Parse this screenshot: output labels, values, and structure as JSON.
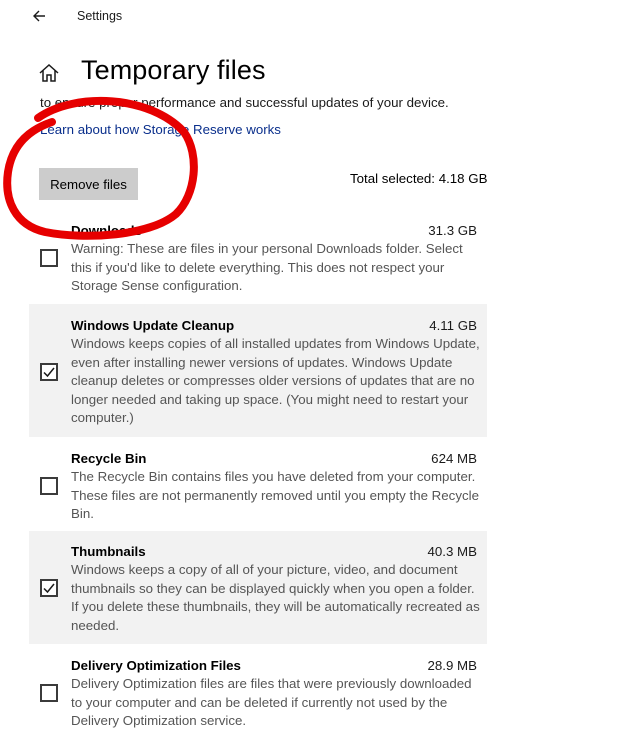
{
  "window": {
    "title": "Settings"
  },
  "page": {
    "title": "Temporary files",
    "description": "to ensure proper performance and successful updates of your device.",
    "learn_link": "Learn about how Storage Reserve works",
    "remove_button": "Remove files",
    "total_selected": "Total selected: 4.18 GB"
  },
  "items": [
    {
      "name": "Downloads",
      "size": "31.3 GB",
      "checked": false,
      "description": "Warning: These are files in your personal Downloads folder. Select this if you'd like to delete everything. This does not respect your Storage Sense configuration."
    },
    {
      "name": "Windows Update Cleanup",
      "size": "4.11 GB",
      "checked": true,
      "description": "Windows keeps copies of all installed updates from Windows Update, even after installing newer versions of updates. Windows Update cleanup deletes or compresses older versions of updates that are no longer needed and taking up space. (You might need to restart your computer.)"
    },
    {
      "name": "Recycle Bin",
      "size": "624 MB",
      "checked": false,
      "description": "The Recycle Bin contains files you have deleted from your computer. These files are not permanently removed until you empty the Recycle Bin."
    },
    {
      "name": "Thumbnails",
      "size": "40.3 MB",
      "checked": true,
      "description": "Windows keeps a copy of all of your picture, video, and document thumbnails so they can be displayed quickly when you open a folder. If you delete these thumbnails, they will be automatically recreated as needed."
    },
    {
      "name": "Delivery Optimization Files",
      "size": "28.9 MB",
      "checked": false,
      "description": "Delivery Optimization files are files that were previously downloaded to your computer and can be deleted if currently not used by the Delivery Optimization service."
    }
  ],
  "colors": {
    "annotation": "#e60000",
    "button_bg": "#cccccc",
    "link": "#0a2f8c",
    "shaded_row": "#f2f2f2"
  },
  "icons": {
    "back": "back-arrow-icon",
    "home": "home-icon",
    "check": "checkmark-icon"
  }
}
